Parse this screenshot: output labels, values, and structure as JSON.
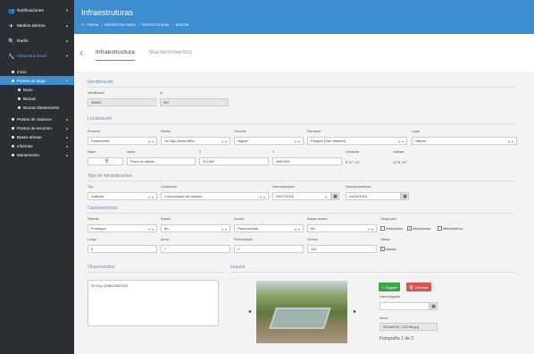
{
  "sidebar": {
    "items": [
      {
        "label": "Notificaciones",
        "icon": "users-icon"
      },
      {
        "label": "Medios aéreos",
        "icon": "plane-icon"
      },
      {
        "label": "Radio",
        "icon": "search-icon"
      },
      {
        "label": "Infraestructuras",
        "icon": "wrench-icon"
      }
    ],
    "sub": [
      {
        "label": "Inicio"
      },
      {
        "label": "Puntos de auga"
      },
      {
        "label": "Novo"
      },
      {
        "label": "Buscar"
      },
      {
        "label": "Buscar Mantemento"
      },
      {
        "label": "Puntos de vixiancia"
      },
      {
        "label": "Puntos de encontro"
      },
      {
        "label": "Bases aéreas"
      },
      {
        "label": "Informes"
      },
      {
        "label": "Mantemento"
      }
    ]
  },
  "header": {
    "title": "Infraestruturas",
    "breadcrumb": [
      "FRIEDA",
      "INFRAESTRUTURAS",
      "PUNTOS DE AUGA",
      "BUSCAR"
    ]
  },
  "tabs": {
    "t1": "Infraestructura",
    "t2": "Mantenimientos"
  },
  "ident": {
    "section": "Identificación",
    "l1": "Identificador",
    "v1": "06650",
    "l2": "Id",
    "v2": "307"
  },
  "loc": {
    "section": "Localización",
    "provincia_l": "Provincia",
    "provincia": "Pontevedra",
    "distrito_l": "Distrito",
    "distrito": "18 Vigo-Baixo Miño",
    "concello_l": "Concello",
    "concello": "Nigrán",
    "parroquia_l": "Parroquia",
    "parroquia": "Priegue (San Martiño)",
    "lugar_l": "Lugar",
    "lugar": "Nabás",
    "mapa_l": "Mapa",
    "nome_l": "Nome",
    "nome": "Pozo de nabás",
    "x_l": "X",
    "x": "517487",
    "y_l": "Y",
    "y": "4667539",
    "lonx_l": "Lonxitude",
    "lonx": "8°47' 10\"",
    "lat_l": "Latitude",
    "lat": "42°8' 20\""
  },
  "tipo": {
    "section": "Tipo de infraestructura",
    "tipo_l": "Tipo",
    "tipo": "Artificial",
    "const_l": "Constructor",
    "const": "Comunidade de Montes",
    "dreal_l": "Data realización",
    "dreal": "25/07/2015",
    "dact_l": "Data actualización",
    "dact": "24/02/2016"
  },
  "car": {
    "section": "Características",
    "mat_l": "Material",
    "mat": "Formigón",
    "est_l": "Estado",
    "est": "Bo",
    "acc_l": "Acceso",
    "acc": "Pista forestal",
    "esta_l": "Estado acceso",
    "esta": "Bo",
    "carga_l": "Carga para",
    "helic": "Helicóptero",
    "motob": "Motobomba",
    "motoc": "Motocisterna",
    "longo_l": "Longo",
    "longo": "6",
    "ancho_l": "Ancho",
    "ancho": "7",
    "prof_l": "Profundidade",
    "prof": "2",
    "vol_l": "Volume",
    "vol": "115",
    "vall_l": "Valado",
    "vall": "Valado"
  },
  "obs": {
    "section": "Observacións",
    "text": "Nº Exp 02360234/2015"
  },
  "img": {
    "section": "Imaxes",
    "engadir": "Engadir",
    "eliminar": "Eliminar",
    "dataf_l": "Data fotografía",
    "nome_l": "Nome",
    "nome": "20150226_132158.jpg",
    "count": "Fotografía 1 de 3"
  }
}
